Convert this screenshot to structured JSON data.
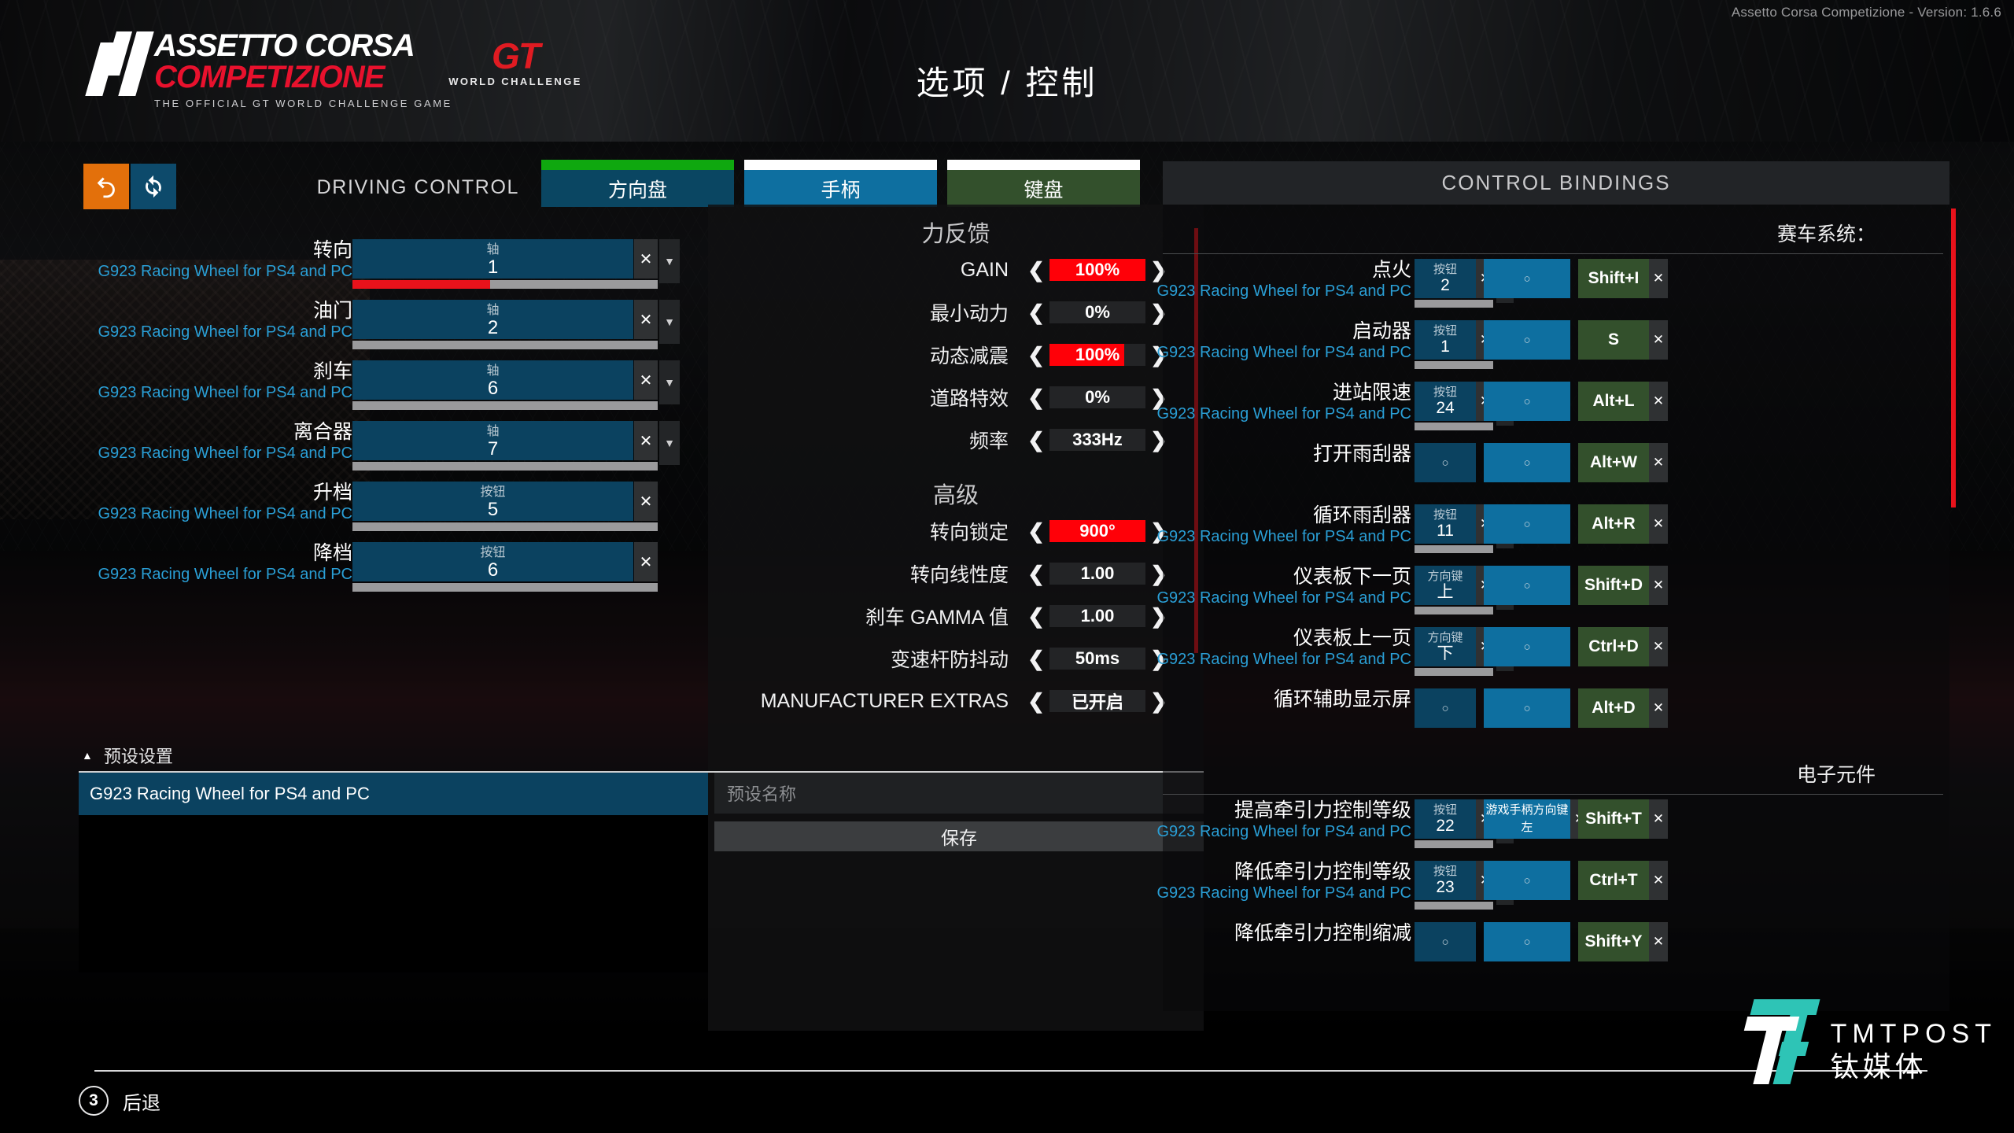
{
  "app": {
    "version_text": "Assetto Corsa Competizione - Version: 1.6.6",
    "logo_line1": "ASSETTO CORSA",
    "logo_line2": "COMPETIZIONE",
    "logo_tagline": "THE OFFICIAL GT WORLD CHALLENGE GAME",
    "gt_logo": "GT",
    "gt_sub": "WORLD CHALLENGE",
    "page_title": "选项 / 控制"
  },
  "toolbar": {
    "undo_icon": "undo-icon",
    "reset_icon": "refresh-icon",
    "section_label": "DRIVING CONTROL",
    "tabs": [
      {
        "label": "方向盘",
        "accent": "#0fa80f",
        "body": "#0a4662",
        "active": true
      },
      {
        "label": "手柄",
        "accent": "#ffffff",
        "body": "#0e6fa0",
        "active": false
      },
      {
        "label": "键盘",
        "accent": "#ffffff",
        "body": "#33502c",
        "active": false
      }
    ]
  },
  "driving_control": {
    "device_name": "G923 Racing Wheel for PS4 and PC",
    "rows": [
      {
        "name": "转向",
        "device": "G923 Racing Wheel for PS4 and PC",
        "kind": "轴",
        "value": "1",
        "has_dropdown": true,
        "bar_fill_pct": 45,
        "bar_red": true
      },
      {
        "name": "油门",
        "device": "G923 Racing Wheel for PS4 and PC",
        "kind": "轴",
        "value": "2",
        "has_dropdown": true,
        "bar_fill_pct": 0,
        "bar_red": false
      },
      {
        "name": "刹车",
        "device": "G923 Racing Wheel for PS4 and PC",
        "kind": "轴",
        "value": "6",
        "has_dropdown": true,
        "bar_fill_pct": 0,
        "bar_red": false
      },
      {
        "name": "离合器",
        "device": "G923 Racing Wheel for PS4 and PC",
        "kind": "轴",
        "value": "7",
        "has_dropdown": true,
        "bar_fill_pct": 0,
        "bar_red": false
      },
      {
        "name": "升档",
        "device": "G923 Racing Wheel for PS4 and PC",
        "kind": "按钮",
        "value": "5",
        "has_dropdown": false,
        "bar_fill_pct": 0,
        "bar_red": false
      },
      {
        "name": "降档",
        "device": "G923 Racing Wheel for PS4 and PC",
        "kind": "按钮",
        "value": "6",
        "has_dropdown": false,
        "bar_fill_pct": 0,
        "bar_red": false
      }
    ],
    "clear_icon": "close-icon",
    "dropdown_icon": "chevron-down-icon"
  },
  "force_feedback": {
    "title": "力反馈",
    "rows": [
      {
        "label": "GAIN",
        "value": "100%",
        "fill_pct": 100,
        "highlight": true
      },
      {
        "label": "最小动力",
        "value": "0%",
        "fill_pct": 0,
        "highlight": false
      },
      {
        "label": "动态减震",
        "value": "100%",
        "fill_pct": 78,
        "highlight": true
      },
      {
        "label": "道路特效",
        "value": "0%",
        "fill_pct": 0,
        "highlight": false
      },
      {
        "label": "频率",
        "value": "333Hz",
        "fill_pct": 0,
        "highlight": false
      }
    ],
    "advanced_title": "高级",
    "advanced_rows": [
      {
        "label": "转向锁定",
        "value": "900°",
        "fill_pct": 100,
        "highlight": true
      },
      {
        "label": "转向线性度",
        "value": "1.00",
        "fill_pct": 0,
        "highlight": false
      },
      {
        "label": "刹车 GAMMA 值",
        "value": "1.00",
        "fill_pct": 0,
        "highlight": false
      },
      {
        "label": "变速杆防抖动",
        "value": "50ms",
        "fill_pct": 0,
        "highlight": false
      },
      {
        "label": "MANUFACTURER EXTRAS",
        "value": "已开启",
        "fill_pct": 0,
        "highlight": false
      }
    ],
    "prev_icon": "chevron-left-icon",
    "next_icon": "chevron-right-icon",
    "accent_color": "#ff0008"
  },
  "preset": {
    "header": "预设设置",
    "collapse_icon": "triangle-up-icon",
    "items": [
      "G923 Racing Wheel for PS4 and PC"
    ],
    "name_placeholder": "预设名称",
    "name_value": "",
    "save_label": "保存"
  },
  "control_bindings": {
    "title": "CONTROL BINDINGS",
    "sections": [
      {
        "title": "赛车系统：",
        "rows": [
          {
            "name": "点火",
            "device": "G923 Racing Wheel for PS4 and PC",
            "wheel": {
              "kind": "按钮",
              "value": "2",
              "dropdown": true,
              "bar": true
            },
            "pad": {
              "value": "○"
            },
            "key": {
              "value": "Shift+I"
            }
          },
          {
            "name": "启动器",
            "device": "G923 Racing Wheel for PS4 and PC",
            "wheel": {
              "kind": "按钮",
              "value": "1",
              "dropdown": false,
              "bar": true
            },
            "pad": {
              "value": "○"
            },
            "key": {
              "value": "S"
            }
          },
          {
            "name": "进站限速",
            "device": "G923 Racing Wheel for PS4 and PC",
            "wheel": {
              "kind": "按钮",
              "value": "24",
              "dropdown": true,
              "bar": true
            },
            "pad": {
              "value": "○"
            },
            "key": {
              "value": "Alt+L"
            }
          },
          {
            "name": "打开雨刮器",
            "device": "",
            "wheel": {
              "kind": "",
              "value": "○",
              "dropdown": false,
              "bar": false
            },
            "pad": {
              "value": "○"
            },
            "key": {
              "value": "Alt+W"
            }
          },
          {
            "name": "循环雨刮器",
            "device": "G923 Racing Wheel for PS4 and PC",
            "wheel": {
              "kind": "按钮",
              "value": "11",
              "dropdown": true,
              "bar": true
            },
            "pad": {
              "value": "○"
            },
            "key": {
              "value": "Alt+R"
            }
          },
          {
            "name": "仪表板下一页",
            "device": "G923 Racing Wheel for PS4 and PC",
            "wheel": {
              "kind": "方向键",
              "value": "上",
              "dropdown": true,
              "bar": true
            },
            "pad": {
              "value": "○"
            },
            "key": {
              "value": "Shift+D"
            }
          },
          {
            "name": "仪表板上一页",
            "device": "G923 Racing Wheel for PS4 and PC",
            "wheel": {
              "kind": "方向键",
              "value": "下",
              "dropdown": true,
              "bar": true
            },
            "pad": {
              "value": "○"
            },
            "key": {
              "value": "Ctrl+D"
            }
          },
          {
            "name": "循环辅助显示屏",
            "device": "",
            "wheel": {
              "kind": "",
              "value": "○",
              "dropdown": false,
              "bar": false
            },
            "pad": {
              "value": "○"
            },
            "key": {
              "value": "Alt+D"
            }
          }
        ]
      },
      {
        "title": "电子元件",
        "rows": [
          {
            "name": "提高牵引力控制等级",
            "device": "G923 Racing Wheel for PS4 and PC",
            "wheel": {
              "kind": "按钮",
              "value": "22",
              "dropdown": true,
              "bar": true
            },
            "pad": {
              "value": "游戏手柄方向键左",
              "small": true
            },
            "key": {
              "value": "Shift+T"
            }
          },
          {
            "name": "降低牵引力控制等级",
            "device": "G923 Racing Wheel for PS4 and PC",
            "wheel": {
              "kind": "按钮",
              "value": "23",
              "dropdown": true,
              "bar": true
            },
            "pad": {
              "value": "○"
            },
            "key": {
              "value": "Ctrl+T"
            }
          },
          {
            "name": "降低牵引力控制缩减",
            "device": "",
            "wheel": {
              "kind": "",
              "value": "○",
              "dropdown": false,
              "bar": false
            },
            "pad": {
              "value": "○"
            },
            "key": {
              "value": "Shift+Y"
            }
          }
        ]
      }
    ],
    "clear_icon": "close-icon",
    "dropdown_icon": "chevron-down-icon"
  },
  "footer": {
    "back_key": "3",
    "back_label": "后退"
  },
  "watermark": {
    "en": "TMTPOST",
    "cn": "钛媒体",
    "accent": "#2ec4b6"
  }
}
